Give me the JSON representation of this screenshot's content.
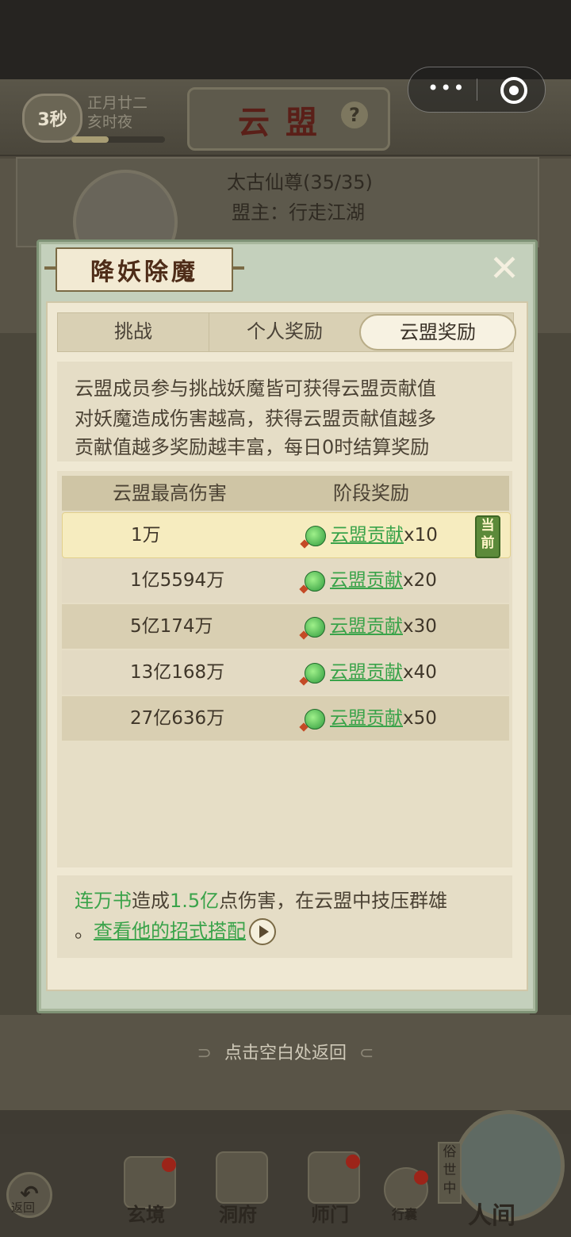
{
  "capsule": {
    "more_icon": "more-dots-icon",
    "close_icon": "target-close-icon"
  },
  "scene": {
    "timer": "3秒",
    "date_line1": "正月廿二",
    "date_line2": "亥时夜",
    "title": "云盟",
    "league_name": "太古仙尊(35/35)",
    "league_leader": "盟主：行走江湖",
    "tap_return": "点击空白处返回",
    "nav": {
      "back": "返回",
      "xuanjing": "玄境",
      "dongfu": "洞府",
      "shimen": "师门",
      "xingnang": "行囊",
      "renjian": "人间",
      "sushizhong": "俗世中"
    }
  },
  "modal": {
    "title": "降妖除魔",
    "tabs": [
      {
        "label": "挑战",
        "active": false
      },
      {
        "label": "个人奖励",
        "active": false
      },
      {
        "label": "云盟奖励",
        "active": true
      }
    ],
    "description": [
      "云盟成员参与挑战妖魔皆可获得云盟贡献值",
      "对妖魔造成伤害越高，获得云盟贡献值越多",
      "贡献值越多奖励越丰富，每日0时结算奖励"
    ],
    "table": {
      "headers": [
        "云盟最高伤害",
        "阶段奖励"
      ],
      "current_badge": "当前",
      "rows": [
        {
          "damage": "1万",
          "reward": "云盟贡献",
          "qty": "x10",
          "current": true
        },
        {
          "damage": "1亿5594万",
          "reward": "云盟贡献",
          "qty": "x20",
          "current": false
        },
        {
          "damage": "5亿174万",
          "reward": "云盟贡献",
          "qty": "x30",
          "current": false
        },
        {
          "damage": "13亿168万",
          "reward": "云盟贡献",
          "qty": "x40",
          "current": false
        },
        {
          "damage": "27亿636万",
          "reward": "云盟贡献",
          "qty": "x50",
          "current": false
        }
      ]
    },
    "note": {
      "player": "连万书",
      "part1": "造成",
      "damage": "1.5亿",
      "part2": "点伤害，在云盟中技压群雄",
      "period": "。",
      "link": "查看他的招式搭配"
    }
  }
}
